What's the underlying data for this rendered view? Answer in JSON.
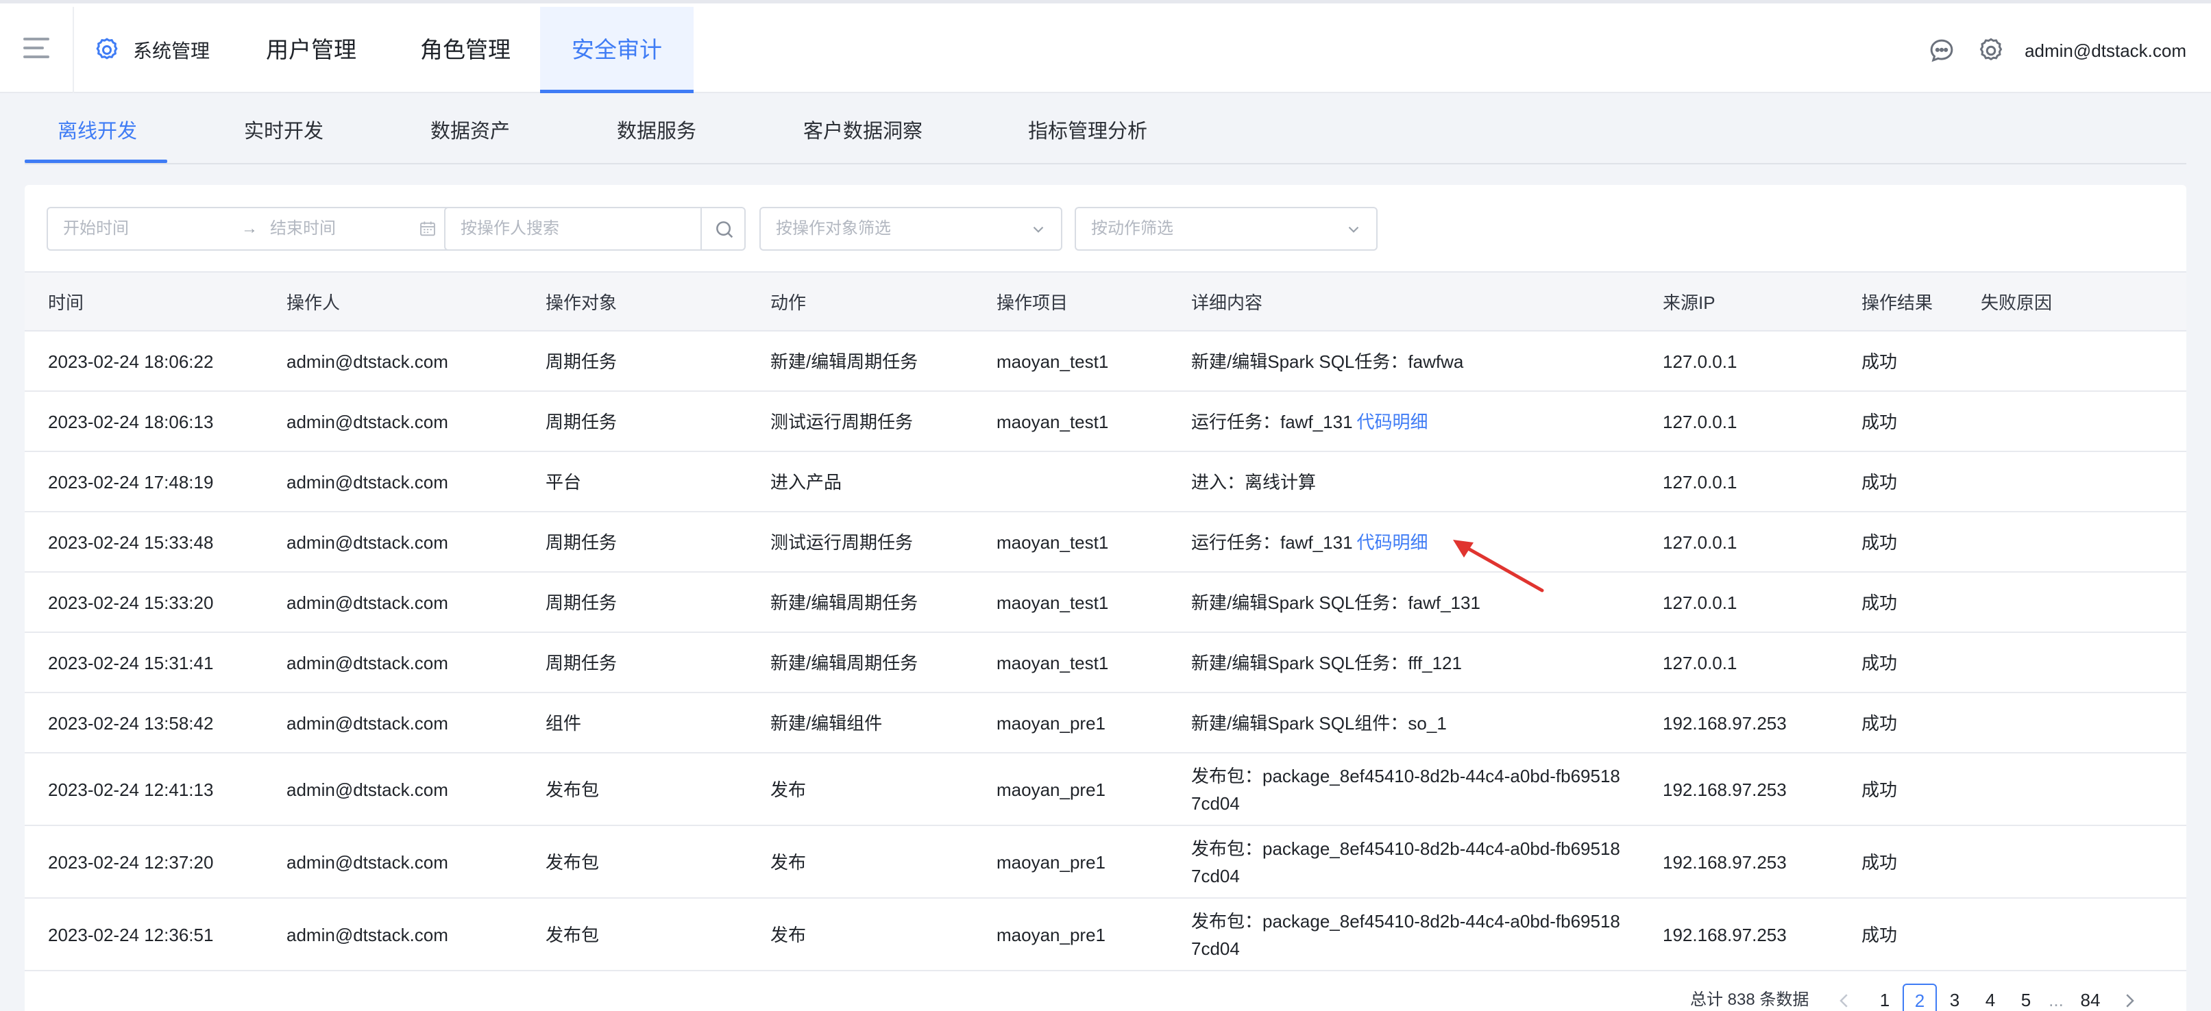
{
  "topnav": {
    "system": "系统管理",
    "tabs": [
      "用户管理",
      "角色管理",
      "安全审计"
    ],
    "active_tab": "安全审计",
    "user_email": "admin@dtstack.com"
  },
  "subtabs": [
    "离线开发",
    "实时开发",
    "数据资产",
    "数据服务",
    "客户数据洞察",
    "指标管理分析"
  ],
  "filters": {
    "start_time": "开始时间",
    "arrow": "→",
    "end_time": "结束时间",
    "operator_search": "按操作人搜索",
    "object_filter": "按操作对象筛选",
    "action_filter": "按动作筛选"
  },
  "table": {
    "columns": [
      "时间",
      "操作人",
      "操作对象",
      "动作",
      "操作项目",
      "详细内容",
      "来源IP",
      "操作结果",
      "失败原因"
    ],
    "rows": [
      {
        "time": "2023-02-24 18:06:22",
        "operator": "admin@dtstack.com",
        "object": "周期任务",
        "action": "新建/编辑周期任务",
        "project": "maoyan_test1",
        "detail": "新建/编辑Spark SQL任务：fawfwa",
        "link": "",
        "ip": "127.0.0.1",
        "result": "成功",
        "reason": ""
      },
      {
        "time": "2023-02-24 18:06:13",
        "operator": "admin@dtstack.com",
        "object": "周期任务",
        "action": "测试运行周期任务",
        "project": "maoyan_test1",
        "detail": "运行任务：fawf_131",
        "link": "代码明细",
        "ip": "127.0.0.1",
        "result": "成功",
        "reason": ""
      },
      {
        "time": "2023-02-24 17:48:19",
        "operator": "admin@dtstack.com",
        "object": "平台",
        "action": "进入产品",
        "project": "",
        "detail": "进入：离线计算",
        "link": "",
        "ip": "127.0.0.1",
        "result": "成功",
        "reason": ""
      },
      {
        "time": "2023-02-24 15:33:48",
        "operator": "admin@dtstack.com",
        "object": "周期任务",
        "action": "测试运行周期任务",
        "project": "maoyan_test1",
        "detail": "运行任务：fawf_131",
        "link": "代码明细",
        "ip": "127.0.0.1",
        "result": "成功",
        "reason": ""
      },
      {
        "time": "2023-02-24 15:33:20",
        "operator": "admin@dtstack.com",
        "object": "周期任务",
        "action": "新建/编辑周期任务",
        "project": "maoyan_test1",
        "detail": "新建/编辑Spark SQL任务：fawf_131",
        "link": "",
        "ip": "127.0.0.1",
        "result": "成功",
        "reason": ""
      },
      {
        "time": "2023-02-24 15:31:41",
        "operator": "admin@dtstack.com",
        "object": "周期任务",
        "action": "新建/编辑周期任务",
        "project": "maoyan_test1",
        "detail": "新建/编辑Spark SQL任务：fff_121",
        "link": "",
        "ip": "127.0.0.1",
        "result": "成功",
        "reason": ""
      },
      {
        "time": "2023-02-24 13:58:42",
        "operator": "admin@dtstack.com",
        "object": "组件",
        "action": "新建/编辑组件",
        "project": "maoyan_pre1",
        "detail": "新建/编辑Spark SQL组件：so_1",
        "link": "",
        "ip": "192.168.97.253",
        "result": "成功",
        "reason": ""
      },
      {
        "time": "2023-02-24 12:41:13",
        "operator": "admin@dtstack.com",
        "object": "发布包",
        "action": "发布",
        "project": "maoyan_pre1",
        "detail": "发布包：package_8ef45410-8d2b-44c4-a0bd-fb695187cd04",
        "link": "",
        "ip": "192.168.97.253",
        "result": "成功",
        "reason": ""
      },
      {
        "time": "2023-02-24 12:37:20",
        "operator": "admin@dtstack.com",
        "object": "发布包",
        "action": "发布",
        "project": "maoyan_pre1",
        "detail": "发布包：package_8ef45410-8d2b-44c4-a0bd-fb695187cd04",
        "link": "",
        "ip": "192.168.97.253",
        "result": "成功",
        "reason": ""
      },
      {
        "time": "2023-02-24 12:36:51",
        "operator": "admin@dtstack.com",
        "object": "发布包",
        "action": "发布",
        "project": "maoyan_pre1",
        "detail": "发布包：package_8ef45410-8d2b-44c4-a0bd-fb695187cd04",
        "link": "",
        "ip": "192.168.97.253",
        "result": "成功",
        "reason": ""
      }
    ]
  },
  "pagination": {
    "total": "总计 838 条数据",
    "pages": [
      "1",
      "2",
      "3",
      "4",
      "5",
      "...",
      "84"
    ],
    "current": "2"
  },
  "colors": {
    "accent": "#3f7cf5",
    "annotation_arrow": "#e0342f"
  }
}
